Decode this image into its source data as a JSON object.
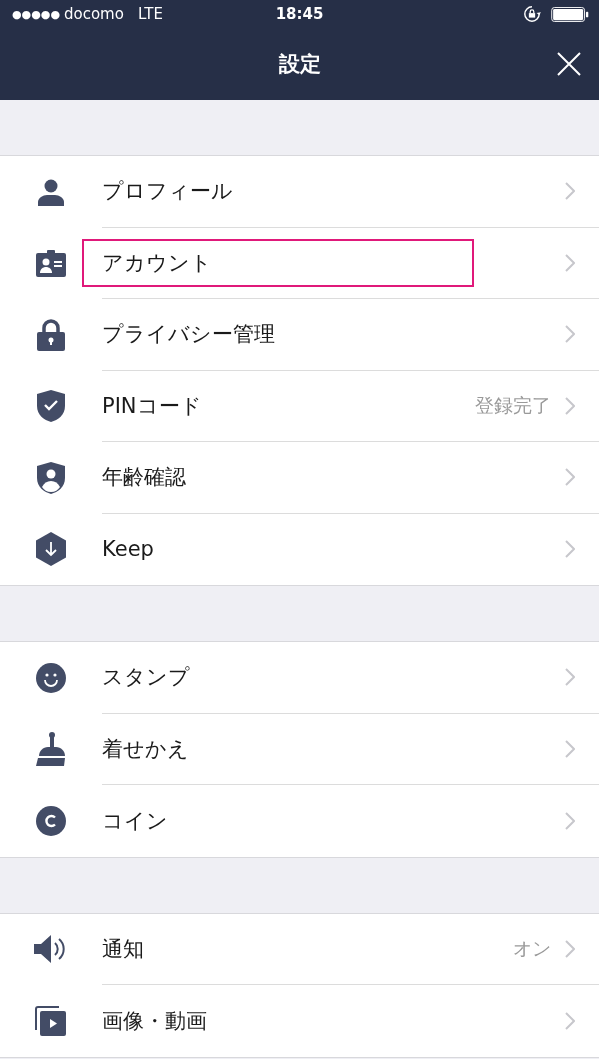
{
  "status_bar": {
    "signal": "●●●●●",
    "carrier": "docomo",
    "network": "LTE",
    "time": "18:45"
  },
  "header": {
    "title": "設定"
  },
  "sections": [
    {
      "items": [
        {
          "label": "プロフィール",
          "highlighted": false
        },
        {
          "label": "アカウント",
          "highlighted": true
        },
        {
          "label": "プライバシー管理",
          "highlighted": false
        },
        {
          "label": "PINコード",
          "value": "登録完了",
          "highlighted": false
        },
        {
          "label": "年齢確認",
          "highlighted": false
        },
        {
          "label": "Keep",
          "highlighted": false
        }
      ]
    },
    {
      "items": [
        {
          "label": "スタンプ",
          "highlighted": false
        },
        {
          "label": "着せかえ",
          "highlighted": false
        },
        {
          "label": "コイン",
          "highlighted": false
        }
      ]
    },
    {
      "items": [
        {
          "label": "通知",
          "value": "オン",
          "highlighted": false
        },
        {
          "label": "画像・動画",
          "highlighted": false
        }
      ]
    }
  ]
}
